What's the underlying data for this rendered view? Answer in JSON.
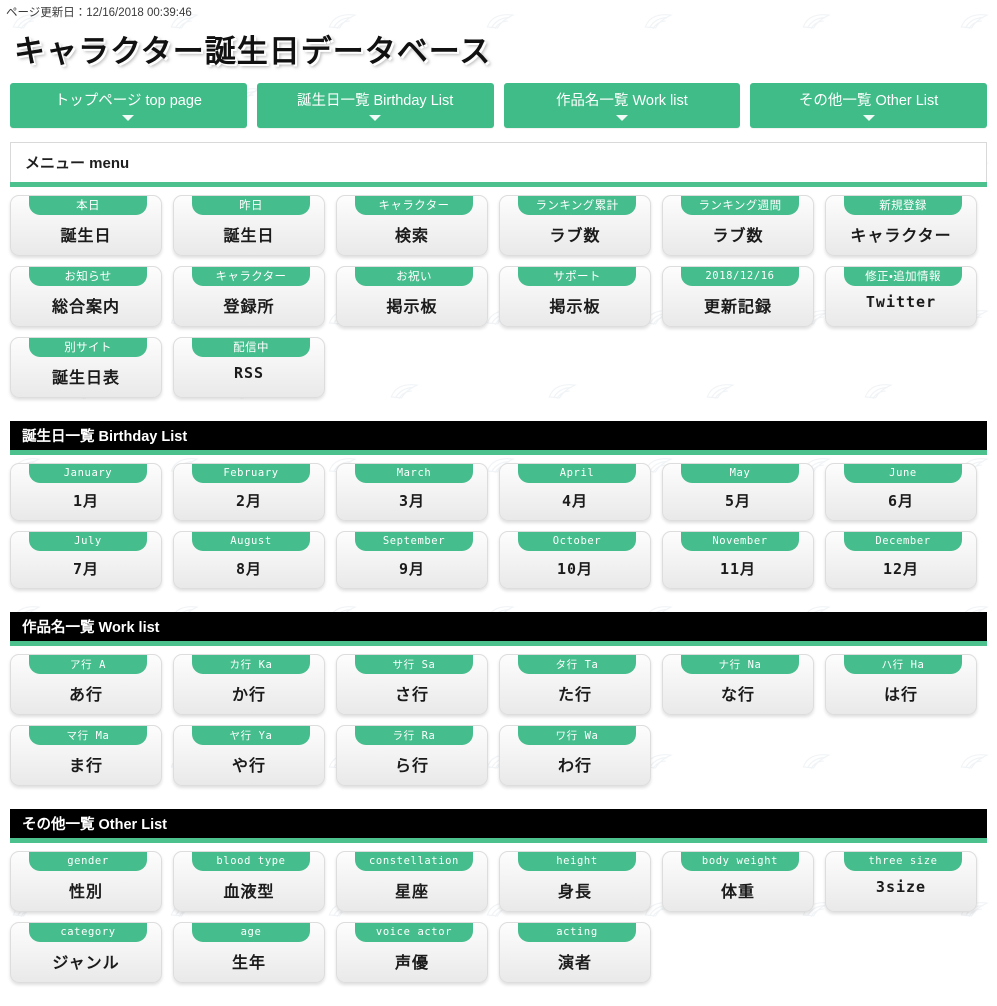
{
  "header": {
    "updated_label": "ページ更新日：12/16/2018 00:39:46",
    "site_title": "キャラクター誕生日データベース"
  },
  "globalnav": [
    {
      "label": "トップページ top page",
      "caret": "chevron-down-icon"
    },
    {
      "label": "誕生日一覧 Birthday List",
      "caret": "chevron-down-icon"
    },
    {
      "label": "作品名一覧 Work list",
      "caret": "chevron-down-icon"
    },
    {
      "label": "その他一覧 Other List",
      "caret": "chevron-down-icon"
    }
  ],
  "menubar": {
    "title": "メニュー menu"
  },
  "sections": [
    {
      "id": "menu",
      "heading": null,
      "cards": [
        {
          "tab": "本日",
          "body": "誕生日",
          "tab_mono": false,
          "body_mono": false
        },
        {
          "tab": "昨日",
          "body": "誕生日",
          "tab_mono": false,
          "body_mono": false
        },
        {
          "tab": "キャラクター",
          "body": "検索",
          "tab_mono": false,
          "body_mono": false
        },
        {
          "tab": "ランキング累計",
          "body": "ラブ数",
          "tab_mono": false,
          "body_mono": false
        },
        {
          "tab": "ランキング週間",
          "body": "ラブ数",
          "tab_mono": false,
          "body_mono": false
        },
        {
          "tab": "新規登録",
          "body": "キャラクター",
          "tab_mono": false,
          "body_mono": false
        },
        {
          "tab": "お知らせ",
          "body": "総合案内",
          "tab_mono": false,
          "body_mono": false
        },
        {
          "tab": "キャラクター",
          "body": "登録所",
          "tab_mono": false,
          "body_mono": false
        },
        {
          "tab": "お祝い",
          "body": "掲示板",
          "tab_mono": false,
          "body_mono": false
        },
        {
          "tab": "サポート",
          "body": "掲示板",
          "tab_mono": false,
          "body_mono": false
        },
        {
          "tab": "2018/12/16",
          "body": "更新記録",
          "tab_mono": true,
          "body_mono": false
        },
        {
          "tab": "修正・追加情報",
          "body": "Twitter",
          "tab_mono": false,
          "body_mono": true
        },
        {
          "tab": "別サイト",
          "body": "誕生日表",
          "tab_mono": false,
          "body_mono": false
        },
        {
          "tab": "配信中",
          "body": "RSS",
          "tab_mono": false,
          "body_mono": true
        }
      ]
    },
    {
      "id": "birthday",
      "heading": "誕生日一覧 Birthday List",
      "cards": [
        {
          "tab": "January",
          "body": "1月",
          "tab_mono": true,
          "body_mono": true
        },
        {
          "tab": "February",
          "body": "2月",
          "tab_mono": true,
          "body_mono": true
        },
        {
          "tab": "March",
          "body": "3月",
          "tab_mono": true,
          "body_mono": true
        },
        {
          "tab": "April",
          "body": "4月",
          "tab_mono": true,
          "body_mono": true
        },
        {
          "tab": "May",
          "body": "5月",
          "tab_mono": true,
          "body_mono": true
        },
        {
          "tab": "June",
          "body": "6月",
          "tab_mono": true,
          "body_mono": true
        },
        {
          "tab": "July",
          "body": "7月",
          "tab_mono": true,
          "body_mono": true
        },
        {
          "tab": "August",
          "body": "8月",
          "tab_mono": true,
          "body_mono": true
        },
        {
          "tab": "September",
          "body": "9月",
          "tab_mono": true,
          "body_mono": true
        },
        {
          "tab": "October",
          "body": "10月",
          "tab_mono": true,
          "body_mono": true
        },
        {
          "tab": "November",
          "body": "11月",
          "tab_mono": true,
          "body_mono": true
        },
        {
          "tab": "December",
          "body": "12月",
          "tab_mono": true,
          "body_mono": true
        }
      ]
    },
    {
      "id": "worklist",
      "heading": "作品名一覧 Work list",
      "cards": [
        {
          "tab": "ア行 A",
          "body": "あ行",
          "tab_mono": true,
          "body_mono": false
        },
        {
          "tab": "カ行 Ka",
          "body": "か行",
          "tab_mono": true,
          "body_mono": false
        },
        {
          "tab": "サ行 Sa",
          "body": "さ行",
          "tab_mono": true,
          "body_mono": false
        },
        {
          "tab": "タ行 Ta",
          "body": "た行",
          "tab_mono": true,
          "body_mono": false
        },
        {
          "tab": "ナ行 Na",
          "body": "な行",
          "tab_mono": true,
          "body_mono": false
        },
        {
          "tab": "ハ行 Ha",
          "body": "は行",
          "tab_mono": true,
          "body_mono": false
        },
        {
          "tab": "マ行 Ma",
          "body": "ま行",
          "tab_mono": true,
          "body_mono": false
        },
        {
          "tab": "ヤ行 Ya",
          "body": "や行",
          "tab_mono": true,
          "body_mono": false
        },
        {
          "tab": "ラ行 Ra",
          "body": "ら行",
          "tab_mono": true,
          "body_mono": false
        },
        {
          "tab": "ワ行 Wa",
          "body": "わ行",
          "tab_mono": true,
          "body_mono": false
        }
      ]
    },
    {
      "id": "otherlist",
      "heading": "その他一覧 Other List",
      "cards": [
        {
          "tab": "gender",
          "body": "性別",
          "tab_mono": true,
          "body_mono": false
        },
        {
          "tab": "blood type",
          "body": "血液型",
          "tab_mono": true,
          "body_mono": false
        },
        {
          "tab": "constellation",
          "body": "星座",
          "tab_mono": true,
          "body_mono": false
        },
        {
          "tab": "height",
          "body": "身長",
          "tab_mono": true,
          "body_mono": false
        },
        {
          "tab": "body weight",
          "body": "体重",
          "tab_mono": true,
          "body_mono": false
        },
        {
          "tab": "three size",
          "body": "3size",
          "tab_mono": true,
          "body_mono": true
        },
        {
          "tab": "category",
          "body": "ジャンル",
          "tab_mono": true,
          "body_mono": false
        },
        {
          "tab": "age",
          "body": "生年",
          "tab_mono": true,
          "body_mono": false
        },
        {
          "tab": "voice actor",
          "body": "声優",
          "tab_mono": true,
          "body_mono": false
        },
        {
          "tab": "acting",
          "body": "演者",
          "tab_mono": true,
          "body_mono": false
        }
      ]
    }
  ],
  "colors": {
    "accent_green": "#3fbc87",
    "tab_green": "#45bd8c",
    "underline_green": "#4cc08d",
    "section_bar": "#000000",
    "card_bg": "#f2f2f2"
  }
}
